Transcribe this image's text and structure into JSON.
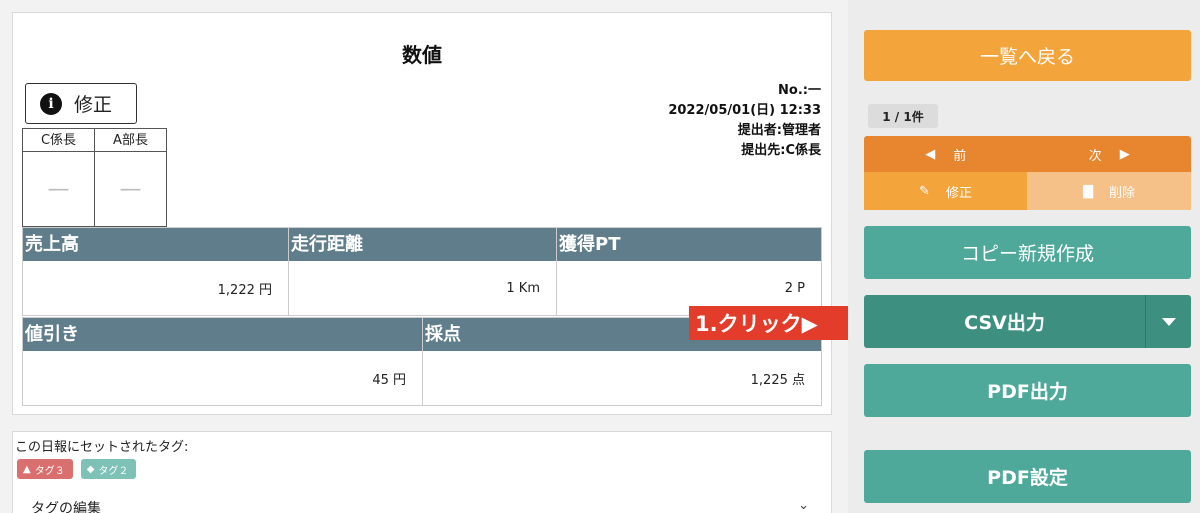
{
  "report": {
    "title": "数値",
    "edit_label": "修正",
    "meta": {
      "number": "No.:一",
      "datetime": "2022/05/01(日) 12:33",
      "submitter": "提出者:管理者",
      "recipient": "提出先:C係長"
    },
    "approvals": [
      {
        "role": "C係長",
        "stamp": "—"
      },
      {
        "role": "A部長",
        "stamp": "—"
      }
    ],
    "stats": [
      {
        "label": "売上高",
        "value": "1,222 円"
      },
      {
        "label": "走行距離",
        "value": "1 Km"
      },
      {
        "label": "獲得PT",
        "value": "2 P"
      },
      {
        "label": "値引き",
        "value": "45 円"
      },
      {
        "label": "採点",
        "value": "1,225 点"
      }
    ]
  },
  "tags": {
    "label": "この日報にセットされたタグ:",
    "items": [
      {
        "name": "タグ３",
        "color": "#d9706f",
        "icon": "warning-icon"
      },
      {
        "name": "タグ２",
        "color": "#7ec1b6",
        "icon": "tag-icon"
      }
    ],
    "edit_label": "タグの編集"
  },
  "callout": {
    "text": "1.クリック▶"
  },
  "sidebar": {
    "back_label": "一覧へ戻る",
    "count": "1 / 1件",
    "prev_label": "前",
    "next_label": "次",
    "edit_label": "修正",
    "delete_label": "削除",
    "copy_label": "コピー新規作成",
    "csv_label": "CSV出力",
    "pdf_label": "PDF出力",
    "pdf_settings_label": "PDF設定"
  },
  "colors": {
    "orange": "#f3a43b",
    "dark_orange": "#e8862f",
    "teal": "#4fa99b",
    "slate": "#607d8b",
    "callout_red": "#e33c2b"
  }
}
